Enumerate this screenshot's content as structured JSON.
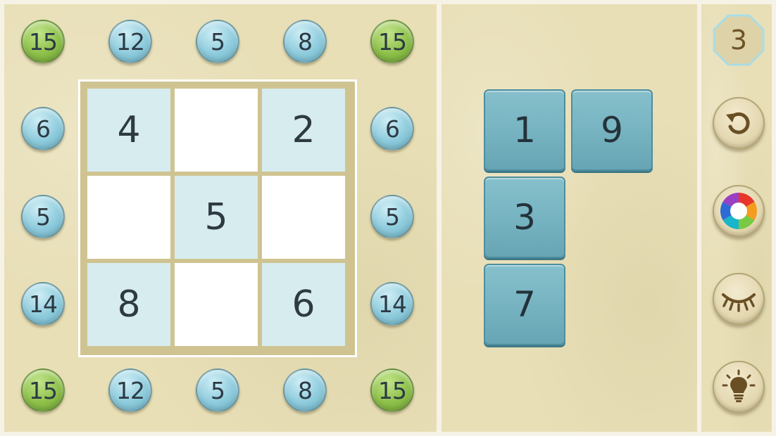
{
  "level": {
    "number": "3"
  },
  "clues": {
    "top": [
      {
        "value": "15",
        "color": "green"
      },
      {
        "value": "12",
        "color": "blue"
      },
      {
        "value": "5",
        "color": "blue"
      },
      {
        "value": "8",
        "color": "blue"
      },
      {
        "value": "15",
        "color": "green"
      }
    ],
    "bottom": [
      {
        "value": "15",
        "color": "green"
      },
      {
        "value": "12",
        "color": "blue"
      },
      {
        "value": "5",
        "color": "blue"
      },
      {
        "value": "8",
        "color": "blue"
      },
      {
        "value": "15",
        "color": "green"
      }
    ],
    "left": [
      {
        "value": "6",
        "color": "blue"
      },
      {
        "value": "5",
        "color": "blue"
      },
      {
        "value": "14",
        "color": "blue"
      }
    ],
    "right": [
      {
        "value": "6",
        "color": "blue"
      },
      {
        "value": "5",
        "color": "blue"
      },
      {
        "value": "14",
        "color": "blue"
      }
    ]
  },
  "grid": {
    "cells": [
      [
        "4",
        "",
        "2"
      ],
      [
        "",
        "5",
        ""
      ],
      [
        "8",
        "",
        "6"
      ]
    ]
  },
  "tray": {
    "tiles": [
      "1",
      "9",
      "3",
      "7"
    ]
  },
  "tools": [
    {
      "name": "undo",
      "icon": "undo-arrow-icon"
    },
    {
      "name": "color-wheel",
      "icon": "color-wheel-icon"
    },
    {
      "name": "hide",
      "icon": "closed-eye-icon"
    },
    {
      "name": "hint",
      "icon": "lightbulb-icon"
    }
  ],
  "colors": {
    "clue_blue": "#8dcbdc",
    "clue_green": "#8dc04a",
    "tile": "#74b1bf",
    "given_cell": "#d6ecef",
    "panel": "#e8dfb7"
  }
}
